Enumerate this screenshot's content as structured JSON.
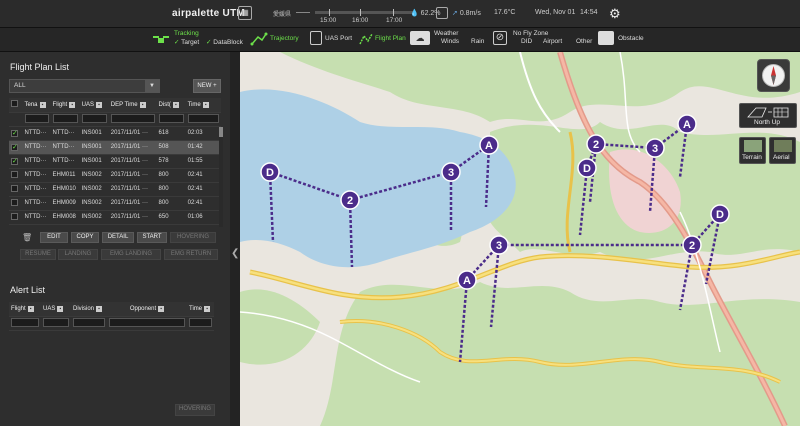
{
  "app": {
    "title": "airpalette UTM"
  },
  "topbar": {
    "timeline_label": "愛媛県",
    "times": [
      "15:00",
      "16:00",
      "17:00"
    ],
    "humidity": "62.2%",
    "wind": "0.8m/s",
    "temperature": "17.6°C",
    "date": "Wed, Nov 01",
    "clock": "14:54"
  },
  "layers": {
    "tracking": "Tracking",
    "target": "Target",
    "datablock": "DataBlock",
    "trajectory": "Trajectory",
    "uas_port": "UAS Port",
    "flight_plan": "Flight Plan",
    "weather": "Weather",
    "winds": "Winds",
    "rain": "Rain",
    "no_fly_zone": "No Fly Zone",
    "did": "DID",
    "airport": "Airport",
    "other": "Other",
    "obstacle": "Obstacle",
    "accent_green": "#6ce04a"
  },
  "flight_plan_list": {
    "title": "Flight Plan List",
    "filter_value": "ALL",
    "new_label": "NEW",
    "columns": [
      "Tena",
      "Flight",
      "UAS",
      "DEP Time",
      "Dist(",
      "Time"
    ],
    "rows": [
      {
        "checked": true,
        "selected": false,
        "tenant": "NTTD···",
        "flight": "NTTD···",
        "uas": "INS001",
        "dep": "2017/11/01 ···",
        "dist": "618",
        "time": "02:03"
      },
      {
        "checked": true,
        "selected": true,
        "tenant": "NTTD···",
        "flight": "NTTD···",
        "uas": "INS001",
        "dep": "2017/11/01 ···",
        "dist": "508",
        "time": "01:42"
      },
      {
        "checked": true,
        "selected": false,
        "tenant": "NTTD···",
        "flight": "NTTD···",
        "uas": "INS001",
        "dep": "2017/11/01 ···",
        "dist": "578",
        "time": "01:55"
      },
      {
        "checked": false,
        "selected": false,
        "tenant": "NTTD···",
        "flight": "EHM011",
        "uas": "INS002",
        "dep": "2017/11/01 ···",
        "dist": "800",
        "time": "02:41"
      },
      {
        "checked": false,
        "selected": false,
        "tenant": "NTTD···",
        "flight": "EHM010",
        "uas": "INS002",
        "dep": "2017/11/01 ···",
        "dist": "800",
        "time": "02:41"
      },
      {
        "checked": false,
        "selected": false,
        "tenant": "NTTD···",
        "flight": "EHM009",
        "uas": "INS002",
        "dep": "2017/11/01 ···",
        "dist": "800",
        "time": "02:41"
      },
      {
        "checked": false,
        "selected": false,
        "tenant": "NTTD···",
        "flight": "EHM008",
        "uas": "INS002",
        "dep": "2017/11/01 ···",
        "dist": "650",
        "time": "01:06"
      }
    ],
    "buttons": {
      "edit": "EDIT",
      "copy": "COPY",
      "detail": "DETAIL",
      "start": "START",
      "hovering": "HOVERING",
      "resume": "RESUME",
      "landing": "LANDING",
      "emg_landing": "EMG LANDING",
      "emg_return": "EMG RETURN"
    }
  },
  "alert_list": {
    "title": "Alert List",
    "columns": [
      "Flight",
      "UAS",
      "Division",
      "Opponent",
      "Time"
    ],
    "hovering": "HOVERING"
  },
  "map": {
    "north_up": "North Up",
    "terrain": "Terrain",
    "aerial": "Aerial",
    "route_color": "#4b2c8a",
    "waypoints": [
      "D",
      "2",
      "3",
      "A",
      "D",
      "2",
      "3",
      "A",
      "D",
      "2",
      "3",
      "A"
    ]
  }
}
